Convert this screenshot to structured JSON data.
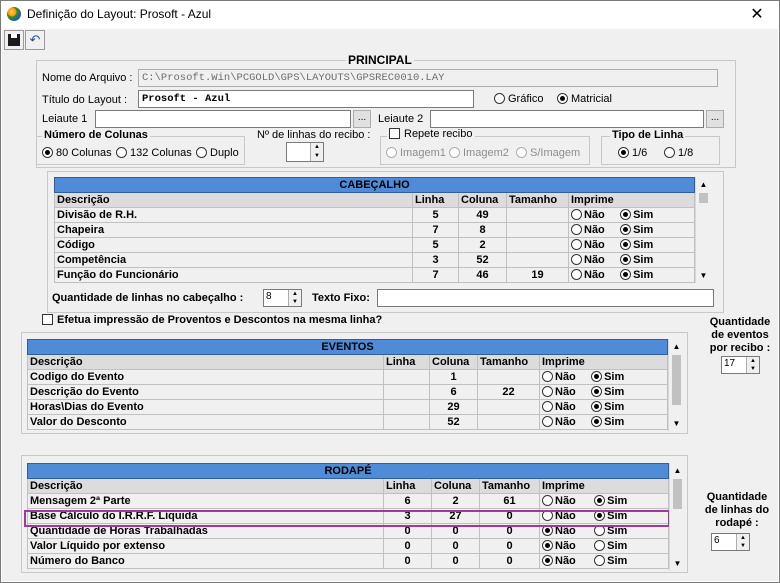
{
  "window": {
    "title": "Definição do Layout: Prosoft - Azul",
    "close": "✕"
  },
  "toolbar": {
    "save": "💾",
    "undo": "↶"
  },
  "principal": {
    "title": "PRINCIPAL",
    "arquivo_label": "Nome do Arquivo :",
    "arquivo_value": "C:\\Prosoft.Win\\PCGOLD\\GPS\\LAYOUTS\\GPSREC0010.LAY",
    "titulo_label": "Título do Layout :",
    "titulo_value": "Prosoft - Azul",
    "grafico": "Gráfico",
    "matricial": "Matricial",
    "leiaute1_label": "Leiaute 1",
    "leiaute2_label": "Leiaute 2",
    "browse": "...",
    "numcol_title": "Número de Colunas",
    "col80": "80 Colunas",
    "col132": "132 Colunas",
    "duplo": "Duplo",
    "nlinhas_label": "Nº de linhas do recibo :",
    "repete_label": "Repete recibo",
    "imagem1": "Imagem1",
    "imagem2": "Imagem2",
    "semimagem": "S/Imagem",
    "tipolinha_title": "Tipo de Linha",
    "l16": "1/6",
    "l18": "1/8"
  },
  "cabecalho": {
    "title": "CABEÇALHO",
    "cols": [
      "Descrição",
      "Linha",
      "Coluna",
      "Tamanho",
      "Imprime"
    ],
    "rows": [
      {
        "d": "Divisão de R.H.",
        "l": "5",
        "c": "49",
        "t": ""
      },
      {
        "d": "Chapeira",
        "l": "7",
        "c": "8",
        "t": ""
      },
      {
        "d": "Código",
        "l": "5",
        "c": "2",
        "t": ""
      },
      {
        "d": "Competência",
        "l": "3",
        "c": "52",
        "t": ""
      },
      {
        "d": "Função do Funcionário",
        "l": "7",
        "c": "46",
        "t": "19"
      }
    ],
    "nao": "Não",
    "sim": "Sim",
    "qtd_label": "Quantidade de linhas no cabeçalho :",
    "qtd_value": "8",
    "texto_label": "Texto Fixo:"
  },
  "efetua_label": "Efetua impressão de Proventos e Descontos na mesma linha?",
  "eventos": {
    "title": "EVENTOS",
    "cols": [
      "Descrição",
      "Linha",
      "Coluna",
      "Tamanho",
      "Imprime"
    ],
    "rows": [
      {
        "d": "Codigo do Evento",
        "l": "",
        "c": "1",
        "t": ""
      },
      {
        "d": "Descrição do Evento",
        "l": "",
        "c": "6",
        "t": "22"
      },
      {
        "d": "Horas\\Dias do Evento",
        "l": "",
        "c": "29",
        "t": ""
      },
      {
        "d": "Valor do Desconto",
        "l": "",
        "c": "52",
        "t": ""
      }
    ],
    "qtd_label1": "Quantidade",
    "qtd_label2": "de eventos",
    "qtd_label3": "por recibo :",
    "qtd_value": "17"
  },
  "rodape": {
    "title": "RODAPÉ",
    "cols": [
      "Descrição",
      "Linha",
      "Coluna",
      "Tamanho",
      "Imprime"
    ],
    "rows": [
      {
        "d": "Mensagem 2ª Parte",
        "l": "6",
        "c": "2",
        "t": "61"
      },
      {
        "d": "Base Cálculo do I.R.R.F. Líquida",
        "l": "3",
        "c": "27",
        "t": "0"
      },
      {
        "d": "Quantidade de Horas Trabalhadas",
        "l": "0",
        "c": "0",
        "t": "0"
      },
      {
        "d": "Valor Líquido por extenso",
        "l": "0",
        "c": "0",
        "t": "0"
      },
      {
        "d": "Número do Banco",
        "l": "0",
        "c": "0",
        "t": "0"
      }
    ],
    "qtd_label1": "Quantidade",
    "qtd_label2": "de linhas do",
    "qtd_label3": "rodapé :",
    "qtd_value": "6"
  }
}
